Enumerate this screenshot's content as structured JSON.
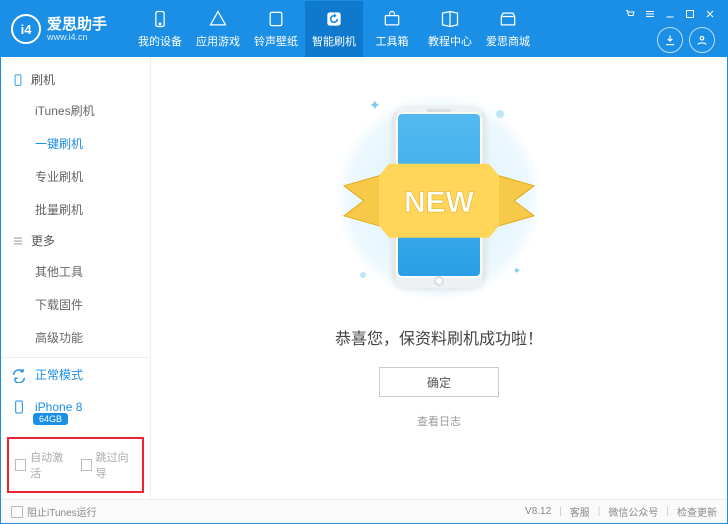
{
  "app": {
    "name": "爱思助手",
    "url": "www.i4.cn",
    "logo": "i4"
  },
  "navs": [
    {
      "id": "devices",
      "label": "我的设备",
      "icon": "phone"
    },
    {
      "id": "apps",
      "label": "应用游戏",
      "icon": "app"
    },
    {
      "id": "rings",
      "label": "铃声壁纸",
      "icon": "note"
    },
    {
      "id": "flash",
      "label": "智能刷机",
      "icon": "refresh",
      "active": true
    },
    {
      "id": "toolbox",
      "label": "工具箱",
      "icon": "tools"
    },
    {
      "id": "tutorial",
      "label": "教程中心",
      "icon": "book"
    },
    {
      "id": "store",
      "label": "爱思商城",
      "icon": "shop"
    }
  ],
  "title_icons": [
    "cart",
    "menu",
    "min",
    "max",
    "close"
  ],
  "right_circ": [
    "download",
    "user"
  ],
  "sidebar": {
    "sections": [
      {
        "head": "刷机",
        "icon": "phone",
        "items": [
          {
            "label": "iTunes刷机"
          },
          {
            "label": "一键刷机",
            "active": true
          },
          {
            "label": "专业刷机"
          },
          {
            "label": "批量刷机"
          }
        ]
      },
      {
        "head": "更多",
        "icon": "list",
        "items": [
          {
            "label": "其他工具"
          },
          {
            "label": "下载固件"
          },
          {
            "label": "高级功能"
          }
        ]
      }
    ],
    "mode": "正常模式",
    "device": "iPhone 8",
    "capacity": "64GB",
    "activation": [
      {
        "label": "自动激活"
      },
      {
        "label": "跳过向导"
      }
    ]
  },
  "main": {
    "message": "恭喜您，保资料刷机成功啦！",
    "ok": "确定",
    "log": "查看日志",
    "ribbon": "NEW"
  },
  "status": {
    "block_itunes": "阻止iTunes运行",
    "version": "V8.12",
    "links": [
      "客服",
      "微信公众号",
      "检查更新"
    ]
  }
}
